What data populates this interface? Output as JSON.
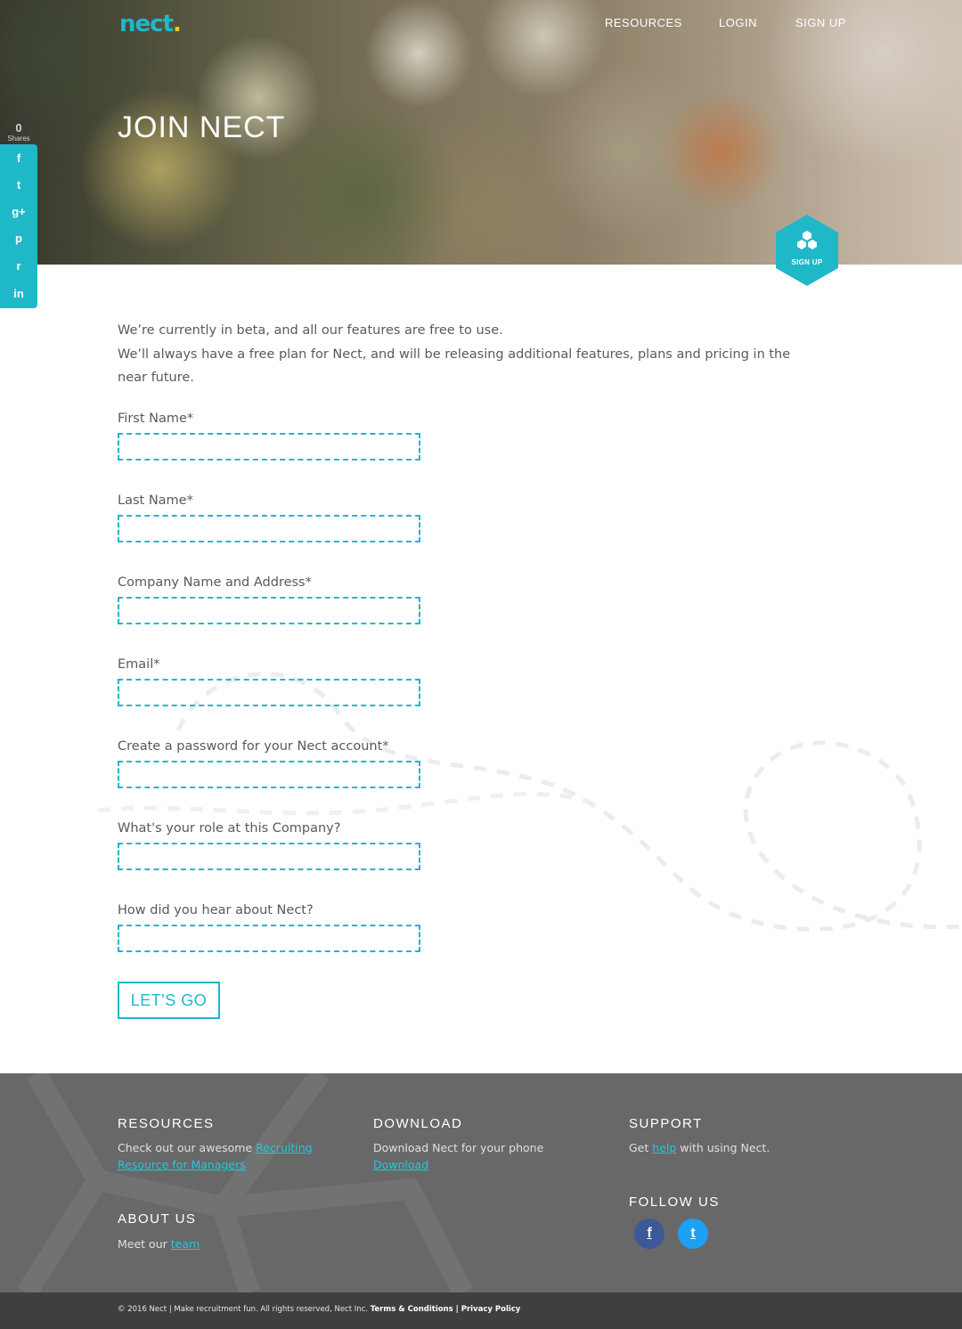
{
  "brand": {
    "logo_text": "nect",
    "logo_dot": ".",
    "accent": "#1fb8c9",
    "dot_color": "#f4c430"
  },
  "nav": {
    "items": [
      "RESOURCES",
      "LOGIN",
      "SIGN UP"
    ]
  },
  "hero": {
    "title": "JOIN NECT",
    "badge_label": "SIGN UP",
    "badge_icon": "hexagon-cluster-icon"
  },
  "share": {
    "count": "0",
    "label": "Shares",
    "icons": [
      "facebook-icon",
      "twitter-icon",
      "google-plus-icon",
      "pinterest-icon",
      "reddit-icon",
      "linkedin-icon"
    ],
    "glyphs": [
      "f",
      "t",
      "g+",
      "p",
      "r",
      "in"
    ]
  },
  "intro": {
    "line1": "We’re currently in beta, and all our features are free to use.",
    "line2": "We’ll always have a free plan for Nect, and will be releasing additional features, plans and pricing in the near future."
  },
  "form": {
    "fields": [
      {
        "label": "First Name*",
        "value": ""
      },
      {
        "label": "Last Name*",
        "value": ""
      },
      {
        "label": "Company Name and Address*",
        "value": ""
      },
      {
        "label": "Email*",
        "value": ""
      },
      {
        "label": "Create a password for your Nect account*",
        "value": ""
      },
      {
        "label": "What's your role at this Company?",
        "value": ""
      },
      {
        "label": "How did you hear about Nect?",
        "value": ""
      }
    ],
    "submit": "LET'S GO"
  },
  "footer": {
    "resources": {
      "title": "RESOURCES",
      "text": "Check out our awesome ",
      "link": "Recruiting Resource for Managers"
    },
    "download": {
      "title": "DOWNLOAD",
      "text": "Download Nect for your phone",
      "link": "Download"
    },
    "support": {
      "title": "SUPPORT",
      "text_before": "Get ",
      "link": "help",
      "text_after": " with using Nect."
    },
    "about": {
      "title": "ABOUT US",
      "text": "Meet our ",
      "link": "team"
    },
    "follow": {
      "title": "FOLLOW US",
      "facebook": "f",
      "twitter": "t"
    },
    "copyright": "© 2016 Nect | Make recruitment fun. All rights reserved, Nect Inc. ",
    "terms": "Terms & Conditions",
    "sep": " | ",
    "privacy": "Privacy Policy"
  }
}
